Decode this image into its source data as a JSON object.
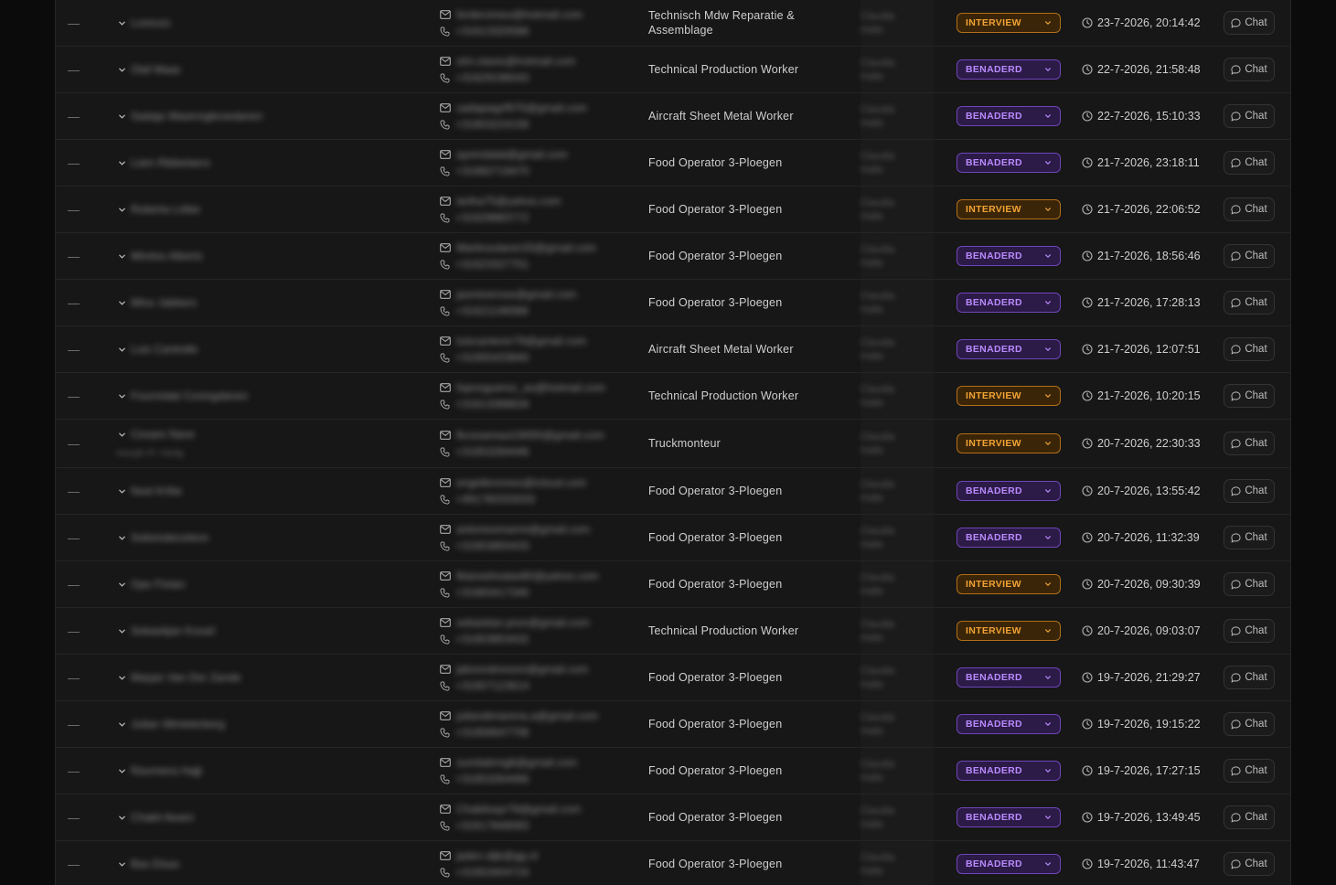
{
  "rows": [
    {
      "dash": "—",
      "name": "Lorenzo",
      "email": "ferderomeo@hotmail.com",
      "phone": "+31613320086",
      "job": "Technisch Mdw Reparatie & Assemblage",
      "recruiter1": "Claudia",
      "recruiter2": "Halle",
      "status": "INTERVIEW",
      "date": "23-7-2026, 20:14:42",
      "chat": "Chat"
    },
    {
      "dash": "—",
      "name": "Olaf Maas",
      "email": "olm.olavis@hotmail.com",
      "phone": "+31629196043",
      "job": "Technical Production Worker",
      "recruiter1": "Claudia",
      "recruiter2": "Halle",
      "status": "BENADERD",
      "date": "22-7-2026, 21:58:48",
      "chat": "Chat"
    },
    {
      "dash": "—",
      "name": "Sadaja Wasinngbroedanen",
      "email": "sadajaagrf975@gmail.com",
      "phone": "+31653224156",
      "job": "Aircraft Sheet Metal Worker",
      "recruiter1": "Claudia",
      "recruiter2": "Halle",
      "status": "BENADERD",
      "date": "22-7-2026, 15:10:33",
      "chat": "Chat"
    },
    {
      "dash": "—",
      "name": "Liam Ribbelaers",
      "email": "ayemdalal@gmail.com",
      "phone": "+31682719470",
      "job": "Food Operator 3-Ploegen",
      "recruiter1": "Claudia",
      "recruiter2": "Halle",
      "status": "BENADERD",
      "date": "21-7-2026, 23:18:11",
      "chat": "Chat"
    },
    {
      "dash": "—",
      "name": "Roberta Lötter",
      "email": "lartha75@yahoo.com",
      "phone": "+31629883772",
      "job": "Food Operator 3-Ploegen",
      "recruiter1": "Claudia",
      "recruiter2": "Halle",
      "status": "INTERVIEW",
      "date": "21-7-2026, 22:06:52",
      "chat": "Chat"
    },
    {
      "dash": "—",
      "name": "Mirelos Albertz",
      "email": "Martinsolaren33@gmail.com",
      "phone": "+31623327751",
      "job": "Food Operator 3-Ploegen",
      "recruiter1": "Claudia",
      "recruiter2": "Halle",
      "status": "BENADERD",
      "date": "21-7-2026, 18:56:46",
      "chat": "Chat"
    },
    {
      "dash": "—",
      "name": "Mino Jabbers",
      "email": "jasminerose@gmail.com",
      "phone": "+31621146089",
      "job": "Food Operator 3-Ploegen",
      "recruiter1": "Claudia",
      "recruiter2": "Halle",
      "status": "BENADERD",
      "date": "21-7-2026, 17:28:13",
      "chat": "Chat"
    },
    {
      "dash": "—",
      "name": "Luis Cantrelle",
      "email": "luiscanterer79@gmail.com",
      "phone": "+31655433840",
      "job": "Aircraft Sheet Metal Worker",
      "recruiter1": "Claudia",
      "recruiter2": "Halle",
      "status": "BENADERD",
      "date": "21-7-2026, 12:07:51",
      "chat": "Chat"
    },
    {
      "dash": "—",
      "name": "Fourmidat Covingdanen",
      "email": "fopnoguerez_ax@hotmail.com",
      "phone": "+31613398634",
      "job": "Technical Production Worker",
      "recruiter1": "Claudia",
      "recruiter2": "Halle",
      "status": "INTERVIEW",
      "date": "21-7-2026, 10:20:15",
      "chat": "Chat"
    },
    {
      "dash": "—",
      "name": "Cesare Nave",
      "extra": "morph Fr Vinity",
      "email": "fkcesareaui19000@gmail.com",
      "phone": "+31653284446",
      "job": "Truckmonteur",
      "recruiter1": "Claudia",
      "recruiter2": "Halle",
      "status": "INTERVIEW",
      "date": "20-7-2026, 22:30:33",
      "chat": "Chat"
    },
    {
      "dash": "—",
      "name": "Noel Krifai",
      "email": "engelbronnes@icloud.com",
      "phone": "+491760333033",
      "job": "Food Operator 3-Ploegen",
      "recruiter1": "Claudia",
      "recruiter2": "Halle",
      "status": "BENADERD",
      "date": "20-7-2026, 13:55:42",
      "chat": "Chat"
    },
    {
      "dash": "—",
      "name": "Soliomdeceleon",
      "email": "antonioomarmi@gmail.com",
      "phone": "+31653850433",
      "job": "Food Operator 3-Ploegen",
      "recruiter1": "Claudia",
      "recruiter2": "Halle",
      "status": "BENADERD",
      "date": "20-7-2026, 11:32:39",
      "chat": "Chat"
    },
    {
      "dash": "—",
      "name": "Ope Fintan",
      "email": "fkianedrealas80@yahoo.com",
      "phone": "+31683417340",
      "job": "Food Operator 3-Ploegen",
      "recruiter1": "Claudia",
      "recruiter2": "Halle",
      "status": "INTERVIEW",
      "date": "20-7-2026, 09:30:39",
      "chat": "Chat"
    },
    {
      "dash": "—",
      "name": "Sebastijan Kovač",
      "email": "sebastian.pron@gmail.com",
      "phone": "+31653853432",
      "job": "Technical Production Worker",
      "recruiter1": "Claudia",
      "recruiter2": "Halle",
      "status": "INTERVIEW",
      "date": "20-7-2026, 09:03:07",
      "chat": "Chat"
    },
    {
      "dash": "—",
      "name": "Marjan Van Der Zande",
      "email": "jaksondresson@gmail.com",
      "phone": "+31657123614",
      "job": "Food Operator 3-Ploegen",
      "recruiter1": "Claudia",
      "recruiter2": "Halle",
      "status": "BENADERD",
      "date": "19-7-2026, 21:29:27",
      "chat": "Chat"
    },
    {
      "dash": "—",
      "name": "Julian Wintelerberg",
      "email": "juliandimarena.a@gmail.com",
      "phone": "+31656647706",
      "job": "Food Operator 3-Ploegen",
      "recruiter1": "Claudia",
      "recruiter2": "Halle",
      "status": "BENADERD",
      "date": "19-7-2026, 19:15:22",
      "chat": "Chat"
    },
    {
      "dash": "—",
      "name": "Ravmiera Hajji",
      "email": "sumitalrmg6@gmail.com",
      "phone": "+31653264466",
      "job": "Food Operator 3-Ploegen",
      "recruiter1": "Claudia",
      "recruiter2": "Halle",
      "status": "BENADERD",
      "date": "19-7-2026, 17:27:15",
      "chat": "Chat"
    },
    {
      "dash": "—",
      "name": "Chakil Awani",
      "email": "Chakilsayr78@gmail.com",
      "phone": "+31617848083",
      "job": "Food Operator 3-Ploegen",
      "recruiter1": "Claudia",
      "recruiter2": "Halle",
      "status": "BENADERD",
      "date": "19-7-2026, 13:49:45",
      "chat": "Chat"
    },
    {
      "dash": "—",
      "name": "Bas Elsas",
      "email": "jaden.dijk@gg.nl",
      "phone": "+31653404724",
      "job": "Food Operator 3-Ploegen",
      "recruiter1": "Claudia",
      "recruiter2": "Halle",
      "status": "BENADERD",
      "date": "19-7-2026, 11:43:47",
      "chat": "Chat"
    }
  ]
}
